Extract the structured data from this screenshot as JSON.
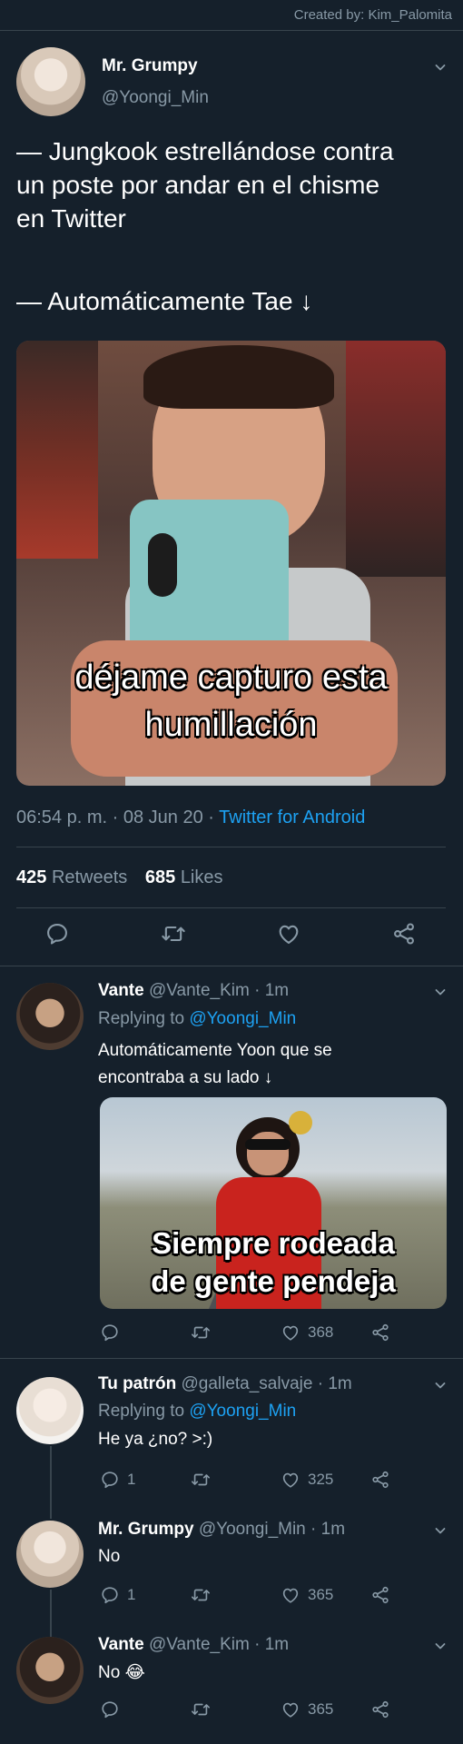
{
  "credit": "Created by: Kim_Palomita",
  "main_tweet": {
    "name": "Mr. Grumpy",
    "handle": "@Yoongi_Min",
    "text_line1": "— Jungkook estrellándose contra",
    "text_line2": "un poste por andar en el chisme",
    "text_line3": "en Twitter",
    "text_line4": "— Automáticamente Tae ↓",
    "image_caption_line1": "déjame capturo esta",
    "image_caption_line2": "humillación",
    "time": "06:54 p. m.",
    "sep": "·",
    "date": "08 Jun 20",
    "source": "Twitter for Android",
    "retweets_count": "425",
    "retweets_label": "Retweets",
    "likes_count": "685",
    "likes_label": "Likes"
  },
  "replies": [
    {
      "name": "Vante",
      "handle": "@Vante_Kim",
      "time": "· 1m",
      "replying_prefix": "Replying to",
      "replying_to": "@Yoongi_Min",
      "text_line1": "Automáticamente Yoon que se",
      "text_line2": "encontraba a su lado ↓",
      "image_caption_line1": "Siempre rodeada",
      "image_caption_line2": "de gente  pendeja",
      "reply_count": "",
      "like_count": "368"
    },
    {
      "name": "Tu patrón",
      "handle": "@galleta_salvaje",
      "time": "· 1m",
      "replying_prefix": "Replying to",
      "replying_to": "@Yoongi_Min",
      "text": "He ya ¿no? >:)",
      "reply_count": "1",
      "like_count": "325"
    },
    {
      "name": "Mr. Grumpy",
      "handle": "@Yoongi_Min",
      "time": "· 1m",
      "text": "No",
      "reply_count": "1",
      "like_count": "365"
    },
    {
      "name": "Vante",
      "handle": "@Vante_Kim",
      "time": "· 1m",
      "text": "No 😂",
      "reply_count": "",
      "like_count": "365"
    }
  ],
  "icons": [
    "reply-icon",
    "retweet-icon",
    "like-icon",
    "share-icon",
    "chevron-down-icon"
  ],
  "colors": {
    "background": "#15202b",
    "text": "#ffffff",
    "muted": "#8899a6",
    "link": "#1da1f2",
    "divider": "#38444d"
  }
}
